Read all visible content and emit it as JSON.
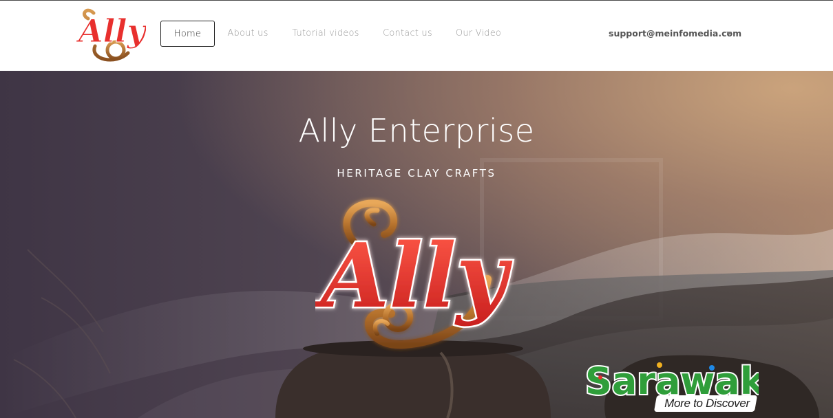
{
  "navbar": {
    "brand_logo_text": "Ally",
    "items": [
      {
        "label": "Home",
        "active": true
      },
      {
        "label": "About us",
        "active": false
      },
      {
        "label": "Tutorial videos",
        "active": false
      },
      {
        "label": "Contact us",
        "active": false
      },
      {
        "label": "Our Video",
        "active": false
      }
    ],
    "email": "support@meinfomedia.com"
  },
  "hero": {
    "title": "Ally Enterprise",
    "subtitle": "HERITAGE CLAY CRAFTS",
    "logo_text": "Ally",
    "sarawak_logo_text": "Sarawak",
    "sarawak_tagline": "More to Discover"
  },
  "colors": {
    "logo_red": "#e8302e",
    "logo_bronze": "#b8742e",
    "nav_text": "#9a9a9a"
  }
}
